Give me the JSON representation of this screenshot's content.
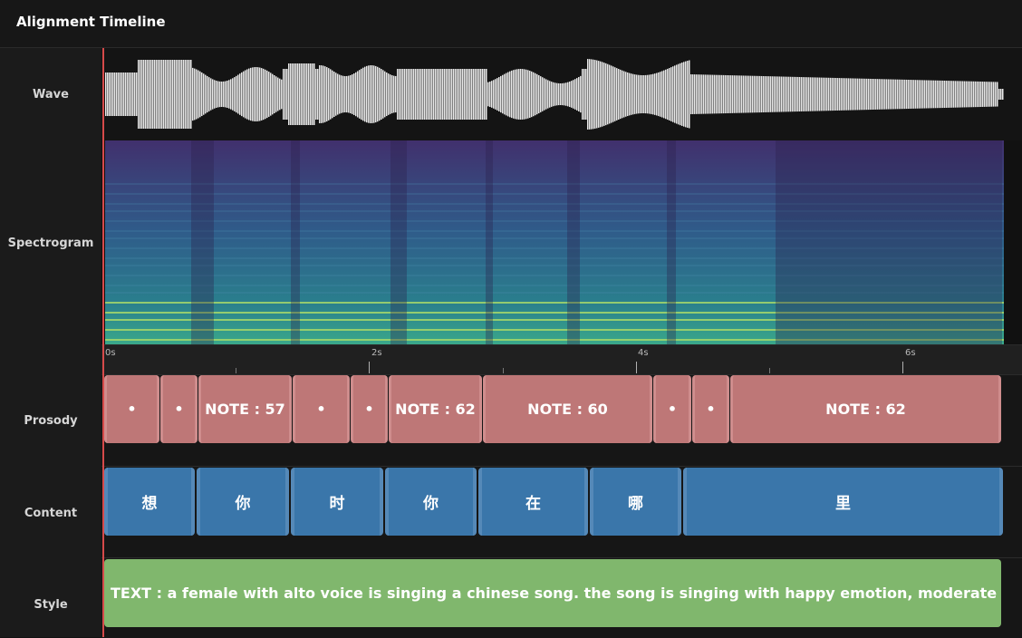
{
  "app": {
    "title": "Alignment Timeline"
  },
  "rows": {
    "wave": "Wave",
    "spectrogram": "Spectrogram",
    "prosody": "Prosody",
    "content": "Content",
    "style": "Style"
  },
  "ruler": {
    "ticks": [
      "0s",
      "2s",
      "4s",
      "6s"
    ]
  },
  "prosody": [
    {
      "label": "•"
    },
    {
      "label": "•"
    },
    {
      "label": "NOTE : 57"
    },
    {
      "label": "•"
    },
    {
      "label": "•"
    },
    {
      "label": "NOTE : 62"
    },
    {
      "label": "NOTE : 60"
    },
    {
      "label": "•"
    },
    {
      "label": "•"
    },
    {
      "label": "NOTE : 62"
    }
  ],
  "content": [
    {
      "label": "想"
    },
    {
      "label": "你"
    },
    {
      "label": "时"
    },
    {
      "label": "你"
    },
    {
      "label": "在"
    },
    {
      "label": "哪"
    },
    {
      "label": "里"
    }
  ],
  "style": {
    "label": "TEXT : a female with alto voice is singing a chinese song. the song is singing with happy emotion, moderate pace, me..."
  },
  "colors": {
    "prosody": "#be7777",
    "content": "#3a76aa",
    "style": "#80b76d",
    "playhead": "#d64a4a"
  }
}
